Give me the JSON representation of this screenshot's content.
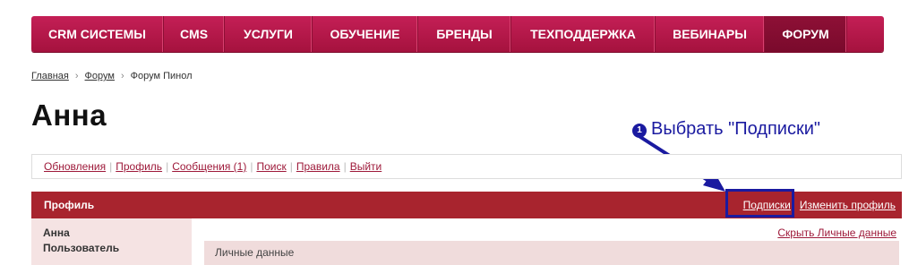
{
  "nav": {
    "items": [
      {
        "label": "CRM СИСТЕМЫ",
        "active": false
      },
      {
        "label": "CMS",
        "active": false
      },
      {
        "label": "УСЛУГИ",
        "active": false
      },
      {
        "label": "ОБУЧЕНИЕ",
        "active": false
      },
      {
        "label": "БРЕНДЫ",
        "active": false
      },
      {
        "label": "ТЕХПОДДЕРЖКА",
        "active": false
      },
      {
        "label": "ВЕБИНАРЫ",
        "active": false
      },
      {
        "label": "ФОРУМ",
        "active": true
      }
    ]
  },
  "breadcrumb": {
    "items": [
      "Главная",
      "Форум",
      "Форум Пинол"
    ],
    "separator": "›"
  },
  "page": {
    "title": "Анна"
  },
  "annotation": {
    "badge": "1",
    "text": "Выбрать \"Подписки\"",
    "color": "#1a1aa0"
  },
  "forum_menu": {
    "items": [
      "Обновления",
      "Профиль",
      "Сообщения (1)",
      "Поиск",
      "Правила",
      "Выйти"
    ],
    "separator": "|"
  },
  "profile_bar": {
    "label": "Профиль",
    "subscriptions_link": "Подписки",
    "edit_profile_link": "Изменить профиль",
    "color": "#a8242e"
  },
  "user": {
    "name": "Анна",
    "role": "Пользователь"
  },
  "personal_data": {
    "hide_link": "Скрыть Личные данные",
    "header": "Личные данные"
  }
}
